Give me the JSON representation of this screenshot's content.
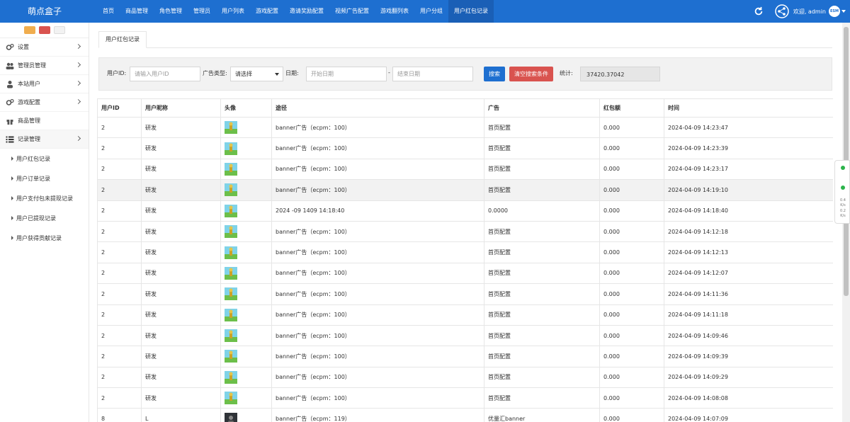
{
  "brand": "萌点盒子",
  "nav": [
    "首页",
    "商品管理",
    "角色管理",
    "管理员",
    "用户列表",
    "游戏配置",
    "邀请奖励配置",
    "视频广告配置",
    "游戏翻列表",
    "用户分组",
    "用户红包记录"
  ],
  "user": {
    "greeting": "欢迎, admin",
    "avatar_text": "ESM"
  },
  "sidebar": {
    "items": [
      {
        "label": "设置",
        "icon": "gears-icon"
      },
      {
        "label": "管理员管理",
        "icon": "users-icon"
      },
      {
        "label": "本站用户",
        "icon": "user-icon"
      },
      {
        "label": "游戏配置",
        "icon": "gears-icon"
      },
      {
        "label": "商品管理",
        "icon": "gift-icon"
      },
      {
        "label": "记录管理",
        "icon": "list-icon"
      }
    ],
    "subitems": [
      "用户红包记录",
      "用户订单记录",
      "用户支付包未提现记录",
      "用户已提现记录",
      "用户获得贡献记录"
    ]
  },
  "tab": "用户红包记录",
  "filters": {
    "uid_label": "用户ID:",
    "uid_placeholder": "请输入用户ID",
    "adtype_label": "广告类型:",
    "adtype_value": "请选择",
    "date_label": "日期:",
    "start_placeholder": "开始日期",
    "dash": "-",
    "end_placeholder": "结束日期",
    "search_label": "搜索",
    "clear_label": "清空搜索条件",
    "stat_label": "统计:",
    "stat_value": "37420.37042"
  },
  "table": {
    "headers": [
      "用户ID",
      "用户昵称",
      "头像",
      "途径",
      "广告",
      "红包额",
      "时间"
    ],
    "rows": [
      {
        "uid": "2",
        "nick": "研发",
        "avatar": "game",
        "route": "banner广告（ecpm：100）",
        "ad": "首页配置",
        "amount": "0.000",
        "time": "2024-04-09 14:23:47"
      },
      {
        "uid": "2",
        "nick": "研发",
        "avatar": "game",
        "route": "banner广告（ecpm：100）",
        "ad": "首页配置",
        "amount": "0.000",
        "time": "2024-04-09 14:23:39"
      },
      {
        "uid": "2",
        "nick": "研发",
        "avatar": "game",
        "route": "banner广告（ecpm：100）",
        "ad": "首页配置",
        "amount": "0.000",
        "time": "2024-04-09 14:23:17"
      },
      {
        "uid": "2",
        "nick": "研发",
        "avatar": "game",
        "route": "banner广告（ecpm：100）",
        "ad": "首页配置",
        "amount": "0.000",
        "time": "2024-04-09 14:19:10"
      },
      {
        "uid": "2",
        "nick": "研发",
        "avatar": "game",
        "route": "2024 -09 1409 14:18:40",
        "ad": "0.0000",
        "amount": "0.000",
        "time": "2024-04-09 14:18:40"
      },
      {
        "uid": "2",
        "nick": "研发",
        "avatar": "game",
        "route": "banner广告（ecpm：100）",
        "ad": "首页配置",
        "amount": "0.000",
        "time": "2024-04-09 14:12:18"
      },
      {
        "uid": "2",
        "nick": "研发",
        "avatar": "game",
        "route": "banner广告（ecpm：100）",
        "ad": "首页配置",
        "amount": "0.000",
        "time": "2024-04-09 14:12:13"
      },
      {
        "uid": "2",
        "nick": "研发",
        "avatar": "game",
        "route": "banner广告（ecpm：100）",
        "ad": "首页配置",
        "amount": "0.000",
        "time": "2024-04-09 14:12:07"
      },
      {
        "uid": "2",
        "nick": "研发",
        "avatar": "game",
        "route": "banner广告（ecpm：100）",
        "ad": "首页配置",
        "amount": "0.000",
        "time": "2024-04-09 14:11:36"
      },
      {
        "uid": "2",
        "nick": "研发",
        "avatar": "game",
        "route": "banner广告（ecpm：100）",
        "ad": "首页配置",
        "amount": "0.000",
        "time": "2024-04-09 14:11:18"
      },
      {
        "uid": "2",
        "nick": "研发",
        "avatar": "game",
        "route": "banner广告（ecpm：100）",
        "ad": "首页配置",
        "amount": "0.000",
        "time": "2024-04-09 14:09:46"
      },
      {
        "uid": "2",
        "nick": "研发",
        "avatar": "game",
        "route": "banner广告（ecpm：100）",
        "ad": "首页配置",
        "amount": "0.000",
        "time": "2024-04-09 14:09:39"
      },
      {
        "uid": "2",
        "nick": "研发",
        "avatar": "game",
        "route": "banner广告（ecpm：100）",
        "ad": "首页配置",
        "amount": "0.000",
        "time": "2024-04-09 14:09:29"
      },
      {
        "uid": "2",
        "nick": "研发",
        "avatar": "game",
        "route": "banner广告（ecpm：100）",
        "ad": "首页配置",
        "amount": "0.000",
        "time": "2024-04-09 14:08:08"
      },
      {
        "uid": "8",
        "nick": "L",
        "avatar": "dark",
        "route": "banner广告（ecpm：119）",
        "ad": "优量汇banner",
        "amount": "0.000",
        "time": "2024-04-09 14:07:09"
      }
    ]
  },
  "float_widget": {
    "val1": "0.4",
    "unit1": "K/s",
    "val2": "0.2",
    "unit2": "K/s"
  },
  "colors": {
    "primary": "#1e6fd0",
    "danger": "#d9534f",
    "warning": "#f0ad4e"
  }
}
